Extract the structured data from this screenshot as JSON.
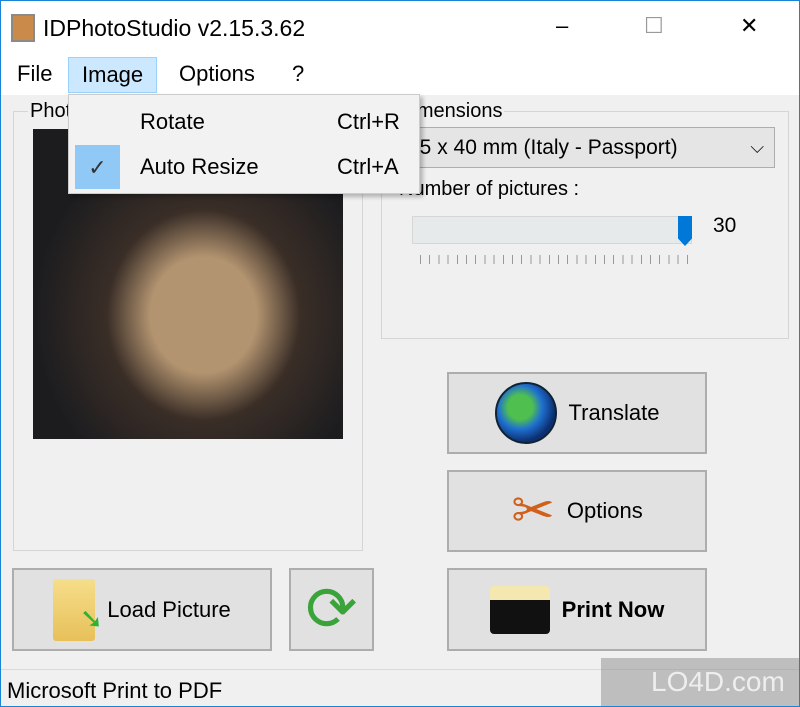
{
  "window": {
    "title": "IDPhotoStudio v2.15.3.62",
    "minimize": "–",
    "maximize": "☐",
    "close": "✕"
  },
  "menubar": [
    {
      "label": "File"
    },
    {
      "label": "Image"
    },
    {
      "label": "Options"
    },
    {
      "label": "?"
    }
  ],
  "image_menu": [
    {
      "label": "Rotate",
      "shortcut": "Ctrl+R",
      "checked": false
    },
    {
      "label": "Auto Resize",
      "shortcut": "Ctrl+A",
      "checked": true,
      "check": "✓"
    }
  ],
  "photo_group": {
    "label": "Photo"
  },
  "dimensions_group": {
    "label": "Dimensions",
    "format_value": "35 x 40 mm (Italy - Passport)",
    "pictures_label": "Number of pictures :",
    "pictures_value": "30",
    "slider_fraction": 1.0
  },
  "buttons": {
    "translate": "Translate",
    "options": "Options",
    "print_now": "Print Now",
    "load_picture": "Load Picture"
  },
  "status": {
    "printer": "Microsoft Print to PDF"
  },
  "watermark": "LO4D.com",
  "colors": {
    "accent": "#1883d7",
    "menu_highlight": "#cce8ff",
    "slider_thumb": "#0078d7"
  }
}
